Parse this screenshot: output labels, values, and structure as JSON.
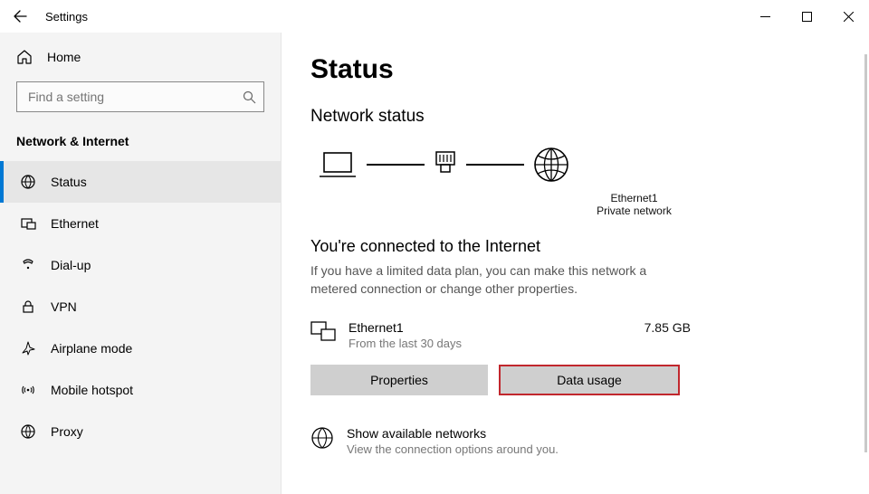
{
  "window": {
    "title": "Settings"
  },
  "sidebar": {
    "home": "Home",
    "search_placeholder": "Find a setting",
    "section": "Network & Internet",
    "items": [
      {
        "label": "Status"
      },
      {
        "label": "Ethernet"
      },
      {
        "label": "Dial-up"
      },
      {
        "label": "VPN"
      },
      {
        "label": "Airplane mode"
      },
      {
        "label": "Mobile hotspot"
      },
      {
        "label": "Proxy"
      }
    ]
  },
  "main": {
    "heading": "Status",
    "subheading": "Network status",
    "diagram": {
      "adapter": "Ethernet1",
      "adapter_sub": "Private network"
    },
    "connected_title": "You're connected to the Internet",
    "connected_body": "If you have a limited data plan, you can make this network a metered connection or change other properties.",
    "connection": {
      "name": "Ethernet1",
      "period": "From the last 30 days",
      "amount": "7.85 GB"
    },
    "buttons": {
      "properties": "Properties",
      "data_usage": "Data usage"
    },
    "available": {
      "title": "Show available networks",
      "sub": "View the connection options around you."
    }
  }
}
